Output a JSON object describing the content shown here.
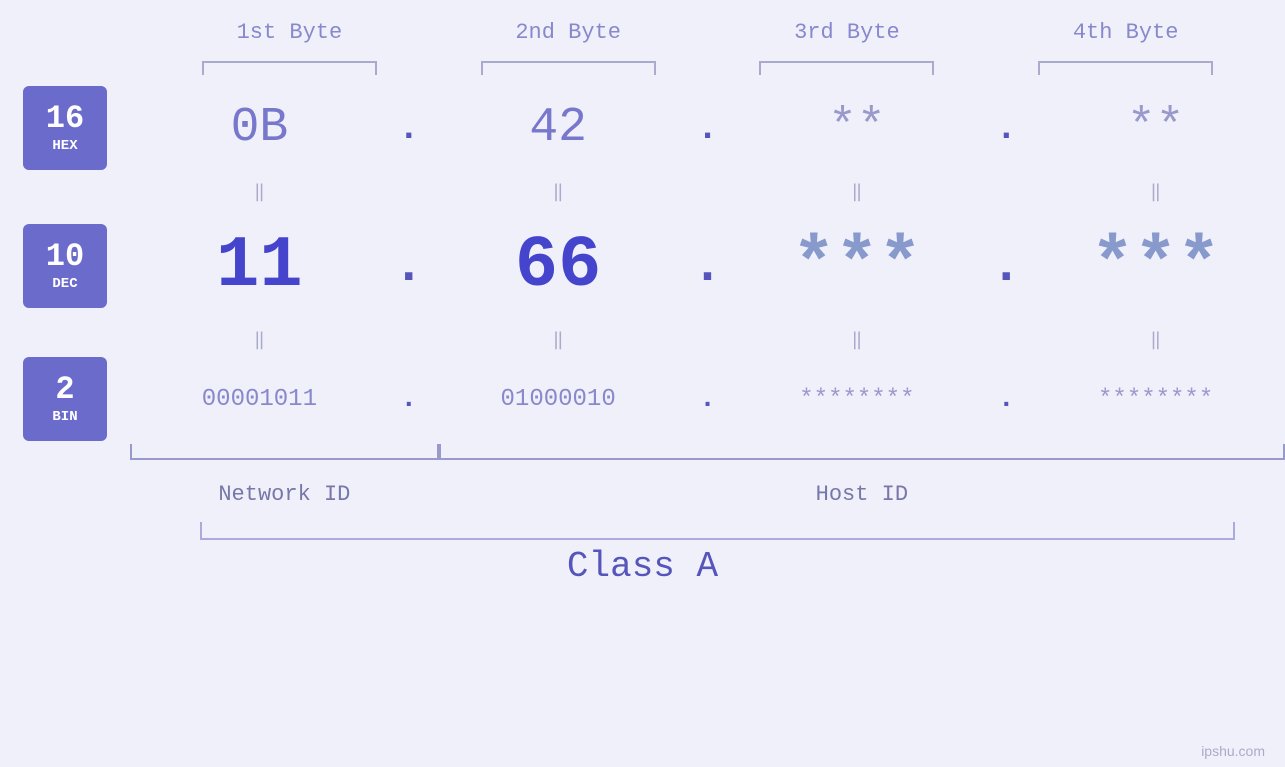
{
  "header": {
    "byte1": "1st Byte",
    "byte2": "2nd Byte",
    "byte3": "3rd Byte",
    "byte4": "4th Byte"
  },
  "bases": {
    "hex": {
      "number": "16",
      "label": "HEX"
    },
    "dec": {
      "number": "10",
      "label": "DEC"
    },
    "bin": {
      "number": "2",
      "label": "BIN"
    }
  },
  "values": {
    "hex": {
      "b1": "0B",
      "b2": "42",
      "b3": "**",
      "b4": "**"
    },
    "dec": {
      "b1": "11",
      "b2": "66",
      "b3": "***",
      "b4": "***"
    },
    "bin": {
      "b1": "00001011",
      "b2": "01000010",
      "b3": "********",
      "b4": "********"
    }
  },
  "labels": {
    "network_id": "Network ID",
    "host_id": "Host ID",
    "class": "Class A",
    "watermark": "ipshu.com"
  }
}
